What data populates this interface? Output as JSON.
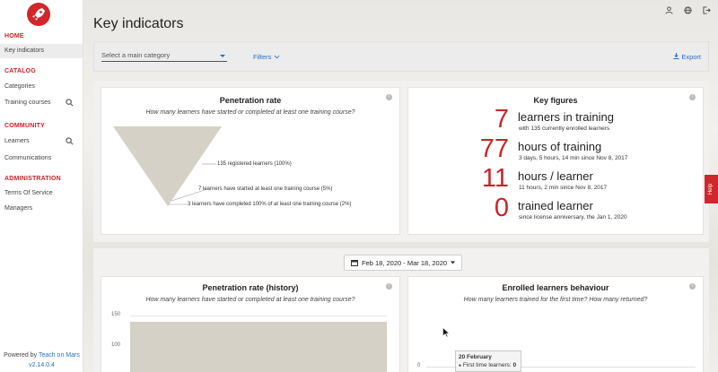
{
  "sidebar": {
    "sections": [
      {
        "title": "HOME",
        "items": [
          {
            "label": "Key indicators",
            "active": true,
            "search": false
          }
        ]
      },
      {
        "title": "CATALOG",
        "items": [
          {
            "label": "Categories",
            "search": false
          },
          {
            "label": "Training courses",
            "search": true
          }
        ]
      },
      {
        "title": "COMMUNITY",
        "items": [
          {
            "label": "Learners",
            "search": true
          },
          {
            "label": "Communications",
            "search": false
          }
        ]
      },
      {
        "title": "ADMINISTRATION",
        "items": [
          {
            "label": "Terms Of Service",
            "search": false
          },
          {
            "label": "Managers",
            "search": false
          }
        ]
      }
    ],
    "powered_prefix": "Powered by ",
    "powered_brand": "Teach on Mars",
    "version": "v2.14.0.4"
  },
  "header": {
    "title": "Key indicators",
    "icons": [
      "user-icon",
      "globe-icon",
      "logout-icon"
    ]
  },
  "toolbar": {
    "select_placeholder": "Select a main category",
    "filters_label": "Filters",
    "export_label": "Export"
  },
  "penetration": {
    "title": "Penetration rate",
    "subtitle": "How many learners have started or completed at least one training course?",
    "labels": [
      "135 registered learners (100%)",
      "7 learners have started at least one training course (5%)",
      "3 learners have completed 100% of at least one training course (2%)"
    ]
  },
  "key_figures": {
    "title": "Key figures",
    "rows": [
      {
        "number": "7",
        "label": "learners in training",
        "sub": "with 135 currently enrolled learners"
      },
      {
        "number": "77",
        "label": "hours of training",
        "sub": "3 days, 5 hours, 14 min since Nov 8, 2017"
      },
      {
        "number": "11",
        "label": "hours / learner",
        "sub": "11 hours, 2 min since Nov 8, 2017"
      },
      {
        "number": "0",
        "label": "trained learner",
        "sub": "since license anniversary, the Jan 1, 2020"
      }
    ]
  },
  "date_range": {
    "label": "Feb 18, 2020 - Mar 18, 2020"
  },
  "history": {
    "title": "Penetration rate (history)",
    "subtitle": "How many learners have started or completed at least one training course?",
    "y_ticks": [
      "150",
      "100"
    ]
  },
  "behaviour": {
    "title": "Enrolled learners behaviour",
    "subtitle": "How many learners trained for the first time? How many returned?",
    "y_tick": "0",
    "tooltip_date": "20 February",
    "tooltip_line": "First time learners:",
    "tooltip_value": "0"
  },
  "help_tab": "Help",
  "colors": {
    "accent": "#c9242a",
    "link": "#2a6ebb",
    "funnel": "#d6d1c6"
  }
}
